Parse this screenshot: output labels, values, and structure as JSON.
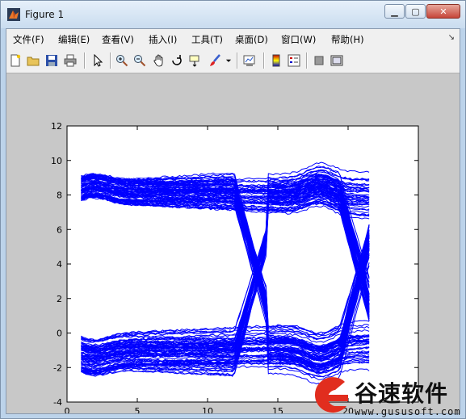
{
  "window": {
    "title": "Figure 1"
  },
  "menu": [
    "文件(F)",
    "编辑(E)",
    "查看(V)",
    "插入(I)",
    "工具(T)",
    "桌面(D)",
    "窗口(W)",
    "帮助(H)"
  ],
  "toolbar_icons": [
    "new-figure-icon",
    "open-file-icon",
    "save-icon",
    "print-icon",
    "select-arrow-icon",
    "zoom-in-icon",
    "zoom-out-icon",
    "pan-hand-icon",
    "rotate-3d-icon",
    "data-cursor-icon",
    "brush-icon",
    "brush-dropdown-icon",
    "link-plot-icon",
    "colorbar-icon",
    "legend-icon",
    "hide-plot-tools-icon",
    "show-plot-tools-icon"
  ],
  "watermark": {
    "text": "谷速软件",
    "url": "www.gususoft.com"
  },
  "chart_data": {
    "type": "line",
    "description_kind": "eye-diagram",
    "title": "",
    "xlabel": "",
    "ylabel": "",
    "xlim": [
      0,
      25
    ],
    "ylim": [
      -4,
      12
    ],
    "xticks": [
      0,
      5,
      10,
      15,
      20,
      25
    ],
    "yticks": [
      -4,
      -2,
      0,
      2,
      4,
      6,
      8,
      10,
      12
    ],
    "xtick_labels": [
      "0",
      "5",
      "10",
      "15",
      "20",
      ""
    ],
    "ytick_labels": [
      "-4",
      "-2",
      "0",
      "2",
      "4",
      "6",
      "8",
      "10",
      "12"
    ],
    "x_range_traces": [
      1,
      21.5
    ],
    "high_level_band": [
      7.5,
      10.5
    ],
    "low_level_band": [
      -2.5,
      0.8
    ],
    "crossing_points": [
      {
        "x": 13.5,
        "y": 4
      },
      {
        "x": 21,
        "y": 4
      }
    ],
    "line_color": "#0000ff",
    "grid": false
  }
}
